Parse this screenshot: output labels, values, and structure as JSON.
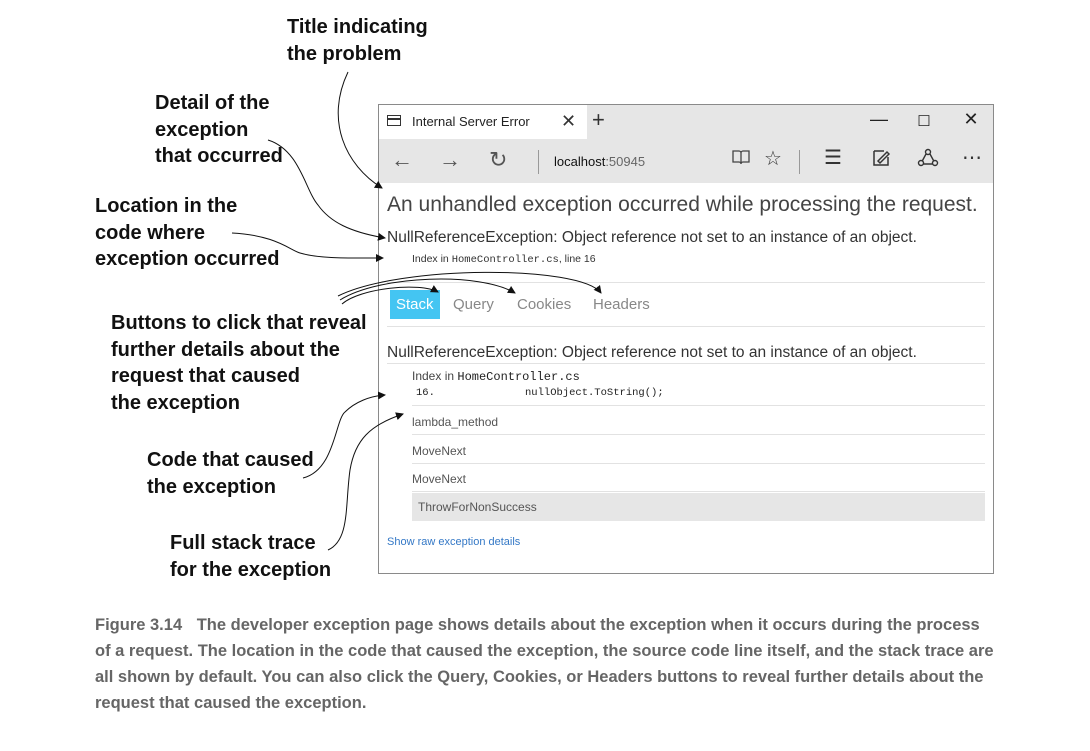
{
  "callouts": {
    "title": [
      "Title indicating",
      "the problem"
    ],
    "detail": [
      "Detail of the",
      "exception",
      "that occurred"
    ],
    "location": [
      "Location in the",
      "code where",
      "exception occurred"
    ],
    "buttons": [
      "Buttons to click that reveal",
      "further details about the",
      "request that caused",
      "the exception"
    ],
    "code": [
      "Code that caused",
      "the exception"
    ],
    "stack": [
      "Full stack trace",
      "for the exception"
    ]
  },
  "browser": {
    "tab_title": "Internal Server Error",
    "tab_close": "✕",
    "new_tab": "+",
    "minimize": "—",
    "maximize": "☐",
    "close": "✕",
    "url_host": "localhost",
    "url_port": ":50945",
    "icons": [
      "back-arrow-icon",
      "forward-arrow-icon",
      "refresh-icon",
      "reading-view-icon",
      "favorite-star-icon",
      "hub-icon",
      "web-note-icon",
      "share-icon",
      "more-icon"
    ]
  },
  "page": {
    "heading": "An unhandled exception occurred while processing the request.",
    "exception": "NullReferenceException: Object reference not set to an instance of an object.",
    "location_prefix": "Index in ",
    "location_file": "HomeController.cs",
    "location_suffix": ", line 16",
    "tabs": [
      "Stack",
      "Query",
      "Cookies",
      "Headers"
    ],
    "stack_exception": "NullReferenceException: Object reference not set to an instance of an object.",
    "frame_prefix": "Index in ",
    "frame_file": "HomeController.cs",
    "code_line_number": "16.",
    "code_line_text": "nullObject.ToString();",
    "frames": [
      "lambda_method",
      "MoveNext",
      "MoveNext",
      "ThrowForNonSuccess"
    ],
    "raw_link": "Show raw exception details"
  },
  "caption": {
    "figure": "Figure 3.14",
    "text": "The developer exception page shows details about the exception when it occurs during the process of a request. The location in the code that caused the exception, the source code line itself, and the stack trace are all shown by default. You can also click the Query, Cookies, or Headers buttons to reveal further details about the request that caused the exception."
  }
}
